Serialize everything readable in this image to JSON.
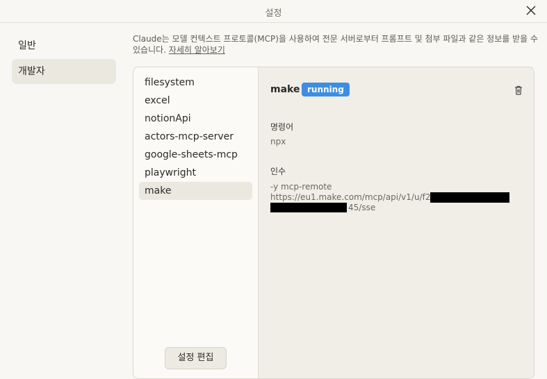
{
  "window": {
    "title": "설정",
    "close_icon": "close-icon"
  },
  "sidebar": {
    "items": [
      {
        "label": "일반"
      },
      {
        "label": "개발자"
      }
    ]
  },
  "intro": {
    "text": "Claude는 모델 컨텍스트 프로토콜(MCP)을 사용하여 전문 서버로부터 프롬프트 및 첨부 파일과 같은 정보를 받을 수\n있습니다. ",
    "link": "자세히 알아보기"
  },
  "servers": {
    "items": [
      {
        "label": "filesystem"
      },
      {
        "label": "excel"
      },
      {
        "label": "notionApi"
      },
      {
        "label": "actors-mcp-server"
      },
      {
        "label": "google-sheets-mcp"
      },
      {
        "label": "playwright"
      },
      {
        "label": "make"
      }
    ],
    "edit_button": "설정 편집"
  },
  "detail": {
    "name": "make",
    "status": "running",
    "status_color": "#3d8ee0",
    "trash_icon": "trash-icon",
    "command_label": "명령어",
    "command_value": "npx",
    "args_label": "인수",
    "args_line1": "-y mcp-remote",
    "args_line2": "https://eu1.make.com/mcp/api/v1/u/f25",
    "args_line3_tail": "45/sse"
  }
}
